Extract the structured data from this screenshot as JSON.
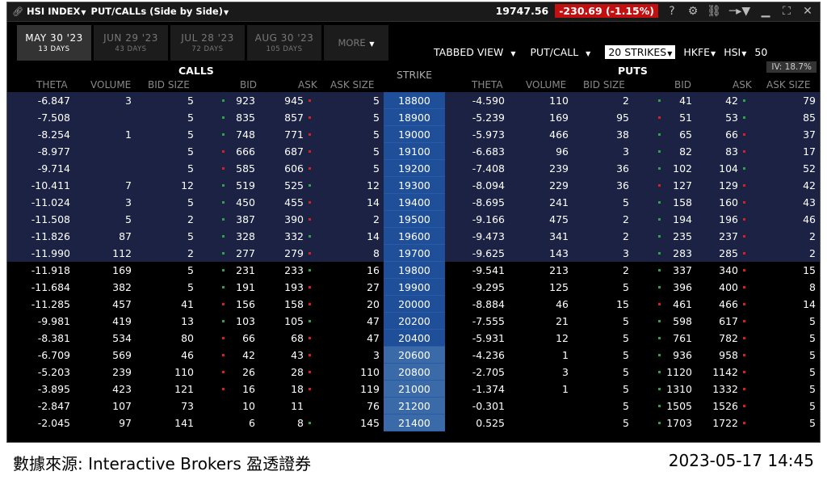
{
  "titlebar": {
    "symbol": "HSI INDEX",
    "view_title": "PUT/CALLs (Side by Side)",
    "last_price": "19747.56",
    "change": "-230.69 (-1.15%)"
  },
  "tabs": [
    {
      "label": "MAY 30 '23",
      "days": "13 DAYS"
    },
    {
      "label": "JUN 29 '23",
      "days": "43 DAYS"
    },
    {
      "label": "JUL 28 '23",
      "days": "72 DAYS"
    },
    {
      "label": "AUG 30 '23",
      "days": "105 DAYS"
    }
  ],
  "more_label": "MORE",
  "controls": {
    "tabbed_view": "TABBED VIEW",
    "put_call": "PUT/CALL",
    "strikes": "20 STRIKES",
    "exchange": "HKFE",
    "underlying": "HSI",
    "multiplier": "50"
  },
  "iv": "IV: 18.7%",
  "headers": {
    "calls": "CALLS",
    "puts": "PUTS",
    "strike": "STRIKE",
    "theta": "THETA",
    "volume": "VOLUME",
    "bid_size": "BID SIZE",
    "bid": "BID",
    "ask": "ASK",
    "ask_size": "ASK SIZE"
  },
  "rows": [
    {
      "ct": "-6.847",
      "cv": "3",
      "cbs": "5",
      "cb": "923",
      "ca": "945",
      "cas": "5",
      "s": "18800",
      "pt": "-4.590",
      "pv": "110",
      "pbs": "2",
      "pb": "41",
      "pa": "42",
      "pas": "79",
      "cbd": "g",
      "cad": "r",
      "pbd": "g",
      "pad": "g"
    },
    {
      "ct": "-7.508",
      "cv": "",
      "cbs": "5",
      "cb": "835",
      "ca": "857",
      "cas": "5",
      "s": "18900",
      "pt": "-5.239",
      "pv": "169",
      "pbs": "95",
      "pb": "51",
      "pa": "53",
      "pas": "85",
      "cbd": "g",
      "cad": "r",
      "pbd": "r",
      "pad": "g"
    },
    {
      "ct": "-8.254",
      "cv": "1",
      "cbs": "5",
      "cb": "748",
      "ca": "771",
      "cas": "5",
      "s": "19000",
      "pt": "-5.973",
      "pv": "466",
      "pbs": "38",
      "pb": "65",
      "pa": "66",
      "pas": "37",
      "cbd": "g",
      "cad": "r",
      "pbd": "g",
      "pad": "r"
    },
    {
      "ct": "-8.977",
      "cv": "",
      "cbs": "5",
      "cb": "666",
      "ca": "687",
      "cas": "5",
      "s": "19100",
      "pt": "-6.683",
      "pv": "96",
      "pbs": "3",
      "pb": "82",
      "pa": "83",
      "pas": "17",
      "cbd": "r",
      "cad": "r",
      "pbd": "g",
      "pad": "r"
    },
    {
      "ct": "-9.714",
      "cv": "",
      "cbs": "5",
      "cb": "585",
      "ca": "606",
      "cas": "5",
      "s": "19200",
      "pt": "-7.408",
      "pv": "239",
      "pbs": "36",
      "pb": "102",
      "pa": "104",
      "pas": "52",
      "cbd": "r",
      "cad": "r",
      "pbd": "g",
      "pad": "g"
    },
    {
      "ct": "-10.411",
      "cv": "7",
      "cbs": "12",
      "cb": "519",
      "ca": "525",
      "cas": "12",
      "s": "19300",
      "pt": "-8.094",
      "pv": "229",
      "pbs": "36",
      "pb": "127",
      "pa": "129",
      "pas": "42",
      "cbd": "g",
      "cad": "g",
      "pbd": "r",
      "pad": "r"
    },
    {
      "ct": "-11.024",
      "cv": "3",
      "cbs": "5",
      "cb": "450",
      "ca": "455",
      "cas": "14",
      "s": "19400",
      "pt": "-8.695",
      "pv": "241",
      "pbs": "5",
      "pb": "158",
      "pa": "160",
      "pas": "43",
      "cbd": "g",
      "cad": "r",
      "pbd": "g",
      "pad": "r"
    },
    {
      "ct": "-11.508",
      "cv": "5",
      "cbs": "2",
      "cb": "387",
      "ca": "390",
      "cas": "2",
      "s": "19500",
      "pt": "-9.166",
      "pv": "475",
      "pbs": "2",
      "pb": "194",
      "pa": "196",
      "pas": "46",
      "cbd": "g",
      "cad": "r",
      "pbd": "g",
      "pad": "r"
    },
    {
      "ct": "-11.826",
      "cv": "87",
      "cbs": "5",
      "cb": "328",
      "ca": "332",
      "cas": "14",
      "s": "19600",
      "pt": "-9.473",
      "pv": "341",
      "pbs": "2",
      "pb": "235",
      "pa": "237",
      "pas": "2",
      "cbd": "g",
      "cad": "g",
      "pbd": "g",
      "pad": "r"
    },
    {
      "ct": "-11.990",
      "cv": "112",
      "cbs": "2",
      "cb": "277",
      "ca": "279",
      "cas": "8",
      "s": "19700",
      "pt": "-9.625",
      "pv": "143",
      "pbs": "3",
      "pb": "283",
      "pa": "285",
      "pas": "2",
      "cbd": "g",
      "cad": "r",
      "pbd": "g",
      "pad": "r"
    },
    {
      "ct": "-11.918",
      "cv": "169",
      "cbs": "5",
      "cb": "231",
      "ca": "233",
      "cas": "16",
      "s": "19800",
      "pt": "-9.541",
      "pv": "213",
      "pbs": "2",
      "pb": "337",
      "pa": "340",
      "pas": "15",
      "cbd": "g",
      "cad": "g",
      "pbd": "g",
      "pad": "r"
    },
    {
      "ct": "-11.684",
      "cv": "382",
      "cbs": "5",
      "cb": "191",
      "ca": "193",
      "cas": "27",
      "s": "19900",
      "pt": "-9.295",
      "pv": "125",
      "pbs": "5",
      "pb": "396",
      "pa": "400",
      "pas": "8",
      "cbd": "g",
      "cad": "r",
      "pbd": "g",
      "pad": "r"
    },
    {
      "ct": "-11.285",
      "cv": "457",
      "cbs": "41",
      "cb": "156",
      "ca": "158",
      "cas": "20",
      "s": "20000",
      "pt": "-8.884",
      "pv": "46",
      "pbs": "15",
      "pb": "461",
      "pa": "466",
      "pas": "14",
      "cbd": "r",
      "cad": "r",
      "pbd": "r",
      "pad": "r"
    },
    {
      "ct": "-9.981",
      "cv": "419",
      "cbs": "13",
      "cb": "103",
      "ca": "105",
      "cas": "47",
      "s": "20200",
      "pt": "-7.555",
      "pv": "21",
      "pbs": "5",
      "pb": "598",
      "pa": "617",
      "pas": "5",
      "cbd": "g",
      "cad": "g",
      "pbd": "g",
      "pad": "r"
    },
    {
      "ct": "-8.381",
      "cv": "534",
      "cbs": "80",
      "cb": "66",
      "ca": "68",
      "cas": "47",
      "s": "20400",
      "pt": "-5.931",
      "pv": "12",
      "pbs": "5",
      "pb": "761",
      "pa": "782",
      "pas": "5",
      "cbd": "r",
      "cad": "r",
      "pbd": "g",
      "pad": "r"
    },
    {
      "ct": "-6.709",
      "cv": "569",
      "cbs": "46",
      "cb": "42",
      "ca": "43",
      "cas": "3",
      "s": "20600",
      "pt": "-4.236",
      "pv": "1",
      "pbs": "5",
      "pb": "936",
      "pa": "958",
      "pas": "5",
      "cbd": "r",
      "cad": "r",
      "pbd": "g",
      "pad": "r"
    },
    {
      "ct": "-5.203",
      "cv": "239",
      "cbs": "110",
      "cb": "26",
      "ca": "28",
      "cas": "110",
      "s": "20800",
      "pt": "-2.705",
      "pv": "3",
      "pbs": "5",
      "pb": "1120",
      "pa": "1142",
      "pas": "5",
      "cbd": "r",
      "cad": "r",
      "pbd": "g",
      "pad": "r"
    },
    {
      "ct": "-3.895",
      "cv": "423",
      "cbs": "121",
      "cb": "16",
      "ca": "18",
      "cas": "119",
      "s": "21000",
      "pt": "-1.374",
      "pv": "1",
      "pbs": "5",
      "pb": "1310",
      "pa": "1332",
      "pas": "5",
      "cbd": "r",
      "cad": "r",
      "pbd": "g",
      "pad": "r"
    },
    {
      "ct": "-2.847",
      "cv": "107",
      "cbs": "73",
      "cb": "10",
      "ca": "11",
      "cas": "76",
      "s": "21200",
      "pt": "-0.301",
      "pv": "",
      "pbs": "5",
      "pb": "1505",
      "pa": "1526",
      "pas": "5",
      "cbd": "",
      "cad": "",
      "pbd": "g",
      "pad": "r"
    },
    {
      "ct": "-2.045",
      "cv": "97",
      "cbs": "141",
      "cb": "6",
      "ca": "8",
      "cas": "145",
      "s": "21400",
      "pt": "0.525",
      "pv": "",
      "pbs": "5",
      "pb": "1703",
      "pa": "1722",
      "pas": "5",
      "cbd": "",
      "cad": "g",
      "pbd": "g",
      "pad": "r"
    }
  ],
  "footer": {
    "source": "數據來源: Interactive Brokers 盈透證券",
    "timestamp": "2023-05-17 14:45"
  },
  "colors": {
    "itm_row": "#1c2244",
    "strike": "#1f4f99",
    "change_bg": "#c21010",
    "bid_up": "#2fa34a",
    "ask_down": "#d92020"
  }
}
